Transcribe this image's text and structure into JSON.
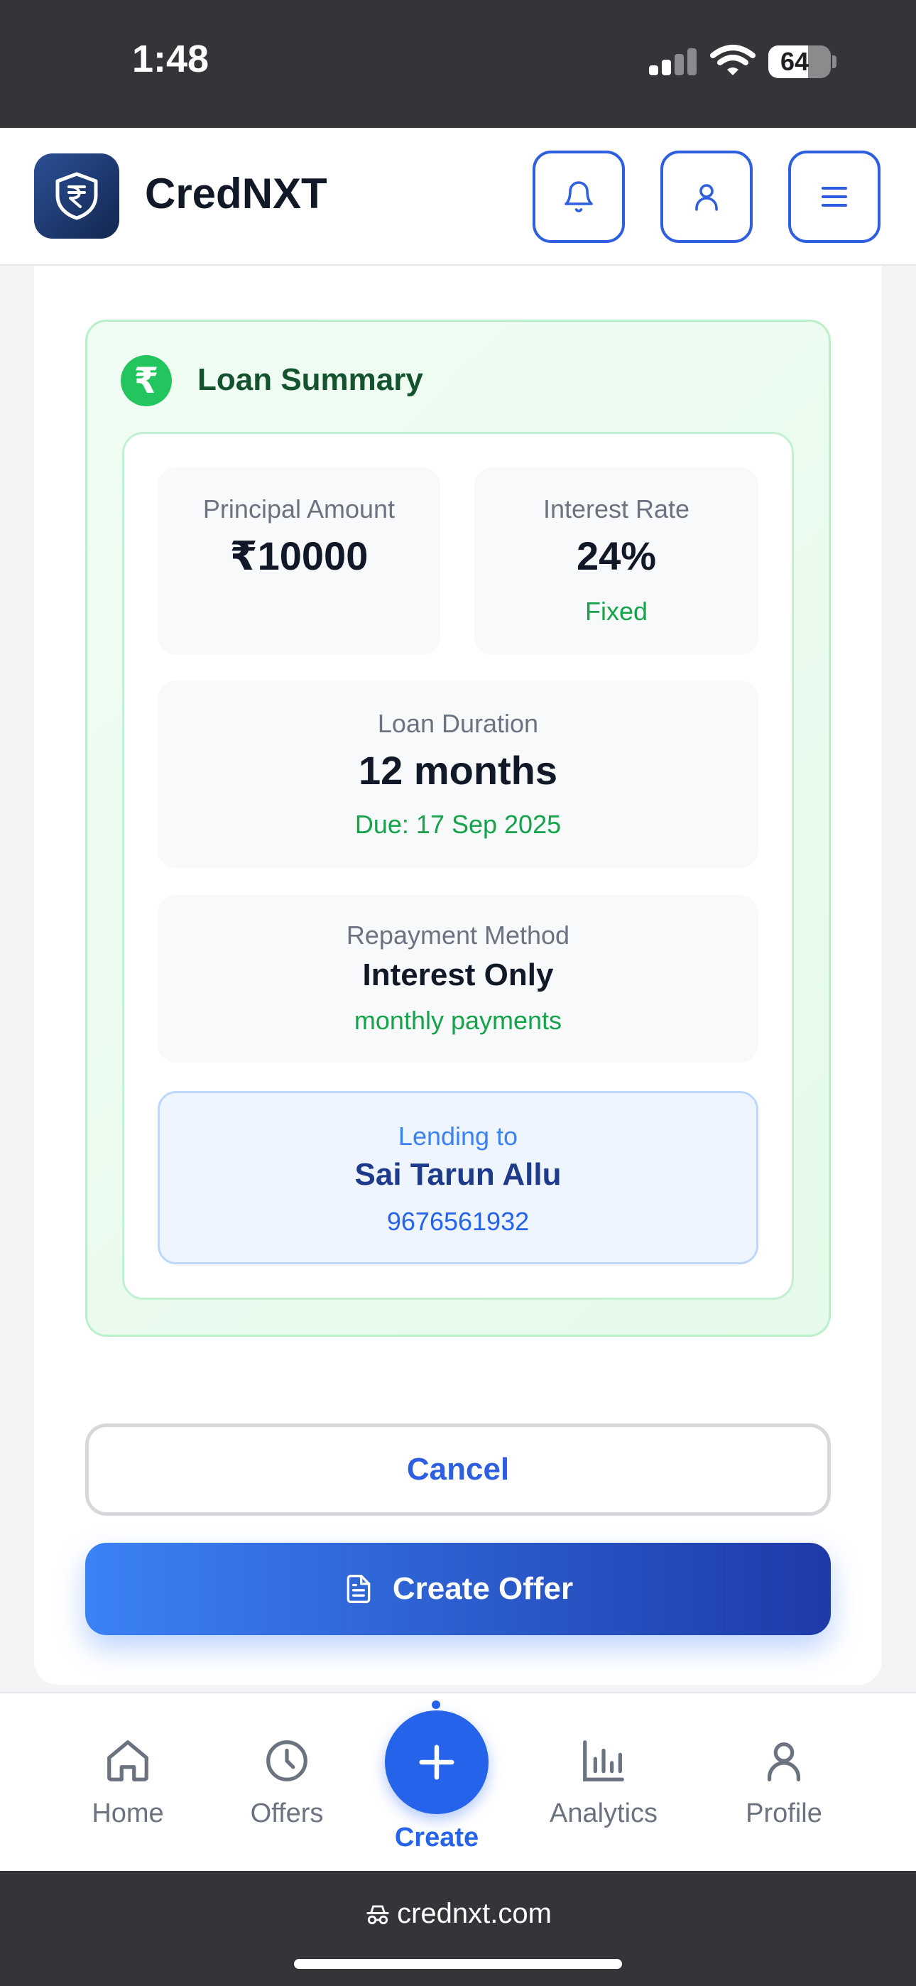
{
  "status_bar": {
    "time": "1:48",
    "battery": "64",
    "battery_level": 0.64
  },
  "header": {
    "app_name": "CredNXT"
  },
  "loan_summary": {
    "title": "Loan Summary",
    "principal": {
      "label": "Principal Amount",
      "value": "₹10000"
    },
    "interest": {
      "label": "Interest Rate",
      "value": "24%",
      "sub": "Fixed"
    },
    "duration": {
      "label": "Loan Duration",
      "value": "12 months",
      "sub": "Due: 17 Sep 2025"
    },
    "repayment": {
      "label": "Repayment Method",
      "value": "Interest Only",
      "sub": "monthly payments"
    },
    "lending": {
      "label": "Lending to",
      "name": "Sai Tarun Allu",
      "phone": "9676561932"
    }
  },
  "actions": {
    "cancel": "Cancel",
    "create_offer": "Create Offer"
  },
  "bottom_nav": {
    "home": "Home",
    "offers": "Offers",
    "create": "Create",
    "analytics": "Analytics",
    "profile": "Profile"
  },
  "browser": {
    "url": "crednxt.com"
  },
  "colors": {
    "primary": "#2563eb",
    "success": "#16a34a",
    "summary_bg": "#f0fdf4",
    "lend_bg": "#eef5ff",
    "system_bar": "#333538"
  },
  "icons": {
    "logo": "rupee-shield-icon",
    "notifications": "bell-icon",
    "account": "user-icon",
    "menu": "hamburger-icon",
    "summary": "rupee-icon",
    "create_offer": "document-icon",
    "nav_home": "home-icon",
    "nav_offers": "clock-icon",
    "nav_create": "plus-icon",
    "nav_analytics": "bar-chart-icon",
    "nav_profile": "user-icon",
    "url_prefix": "incognito-icon"
  }
}
